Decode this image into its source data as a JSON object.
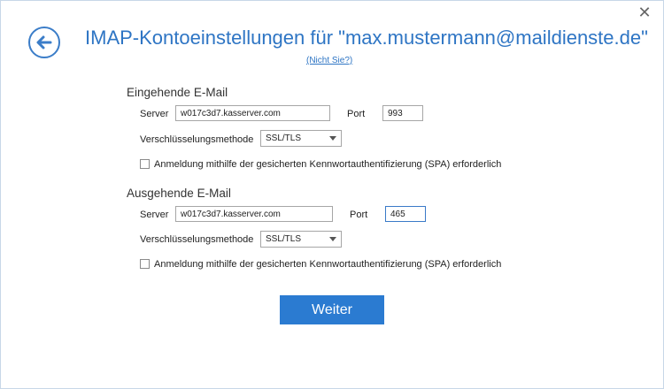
{
  "window": {
    "title": "IMAP-Kontoeinstellungen für \"max.mustermann@maildienste.de\"",
    "not_you_link": "(Nicht Sie?)",
    "close_glyph": "✕",
    "back_icon": "arrow-left-circle-icon"
  },
  "incoming": {
    "heading": "Eingehende E-Mail",
    "server_label": "Server",
    "server_value": "w017c3d7.kasserver.com",
    "port_label": "Port",
    "port_value": "993",
    "encryption_label": "Verschlüsselungsmethode",
    "encryption_value": "SSL/TLS",
    "spa_label": "Anmeldung mithilfe der gesicherten Kennwortauthentifizierung (SPA) erforderlich",
    "spa_checked": false
  },
  "outgoing": {
    "heading": "Ausgehende E-Mail",
    "server_label": "Server",
    "server_value": "w017c3d7.kasserver.com",
    "port_label": "Port",
    "port_value": "465",
    "encryption_label": "Verschlüsselungsmethode",
    "encryption_value": "SSL/TLS",
    "spa_label": "Anmeldung mithilfe der gesicherten Kennwortauthentifizierung (SPA) erforderlich",
    "spa_checked": false
  },
  "actions": {
    "next_label": "Weiter"
  },
  "colors": {
    "accent": "#2e75c4",
    "button": "#2b7bd1"
  }
}
